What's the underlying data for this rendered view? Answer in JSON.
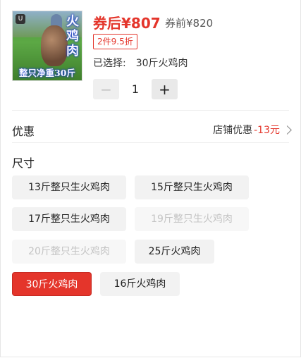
{
  "product": {
    "image_logo": "U",
    "image_side_text": "火鸡肉",
    "image_bottom_text": "整只净重30斤",
    "price_after_coupon": "券后¥807",
    "price_before_coupon": "券前¥820",
    "discount_tag": "2件9.5折",
    "selected_label": "已选择:",
    "selected_value": "30斤火鸡肉"
  },
  "quantity": {
    "minus": "−",
    "value": "1",
    "plus": "+"
  },
  "promo": {
    "title": "优惠",
    "label": "店铺优惠",
    "amount": "-13元"
  },
  "size": {
    "title": "尺寸",
    "options": [
      {
        "label": "13斤整只生火鸡肉",
        "state": "normal"
      },
      {
        "label": "15斤整只生火鸡肉",
        "state": "normal"
      },
      {
        "label": "17斤整只生火鸡肉",
        "state": "normal"
      },
      {
        "label": "19斤整只生火鸡肉",
        "state": "disabled"
      },
      {
        "label": "20斤整只生火鸡肉",
        "state": "disabled"
      },
      {
        "label": "25斤火鸡肉",
        "state": "normal"
      },
      {
        "label": "30斤火鸡肉",
        "state": "selected"
      },
      {
        "label": "16斤火鸡肉",
        "state": "normal"
      }
    ]
  },
  "colors": {
    "accent": "#e4352b",
    "chip_bg": "#f2f2f2",
    "disabled_text": "#c4c4c4"
  }
}
